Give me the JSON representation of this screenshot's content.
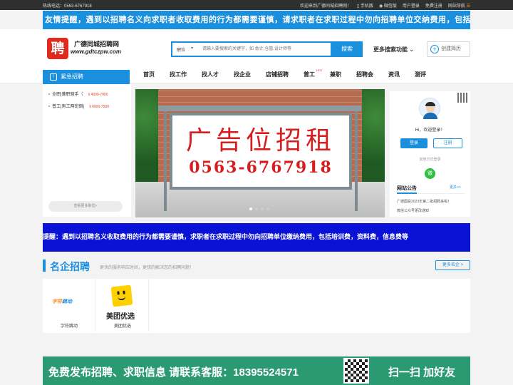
{
  "topbar": {
    "hotline": "热线电话：0563-6767918",
    "welcome": "欢迎来到广德同城招聘网！",
    "mobile": "手机版",
    "wechat": "微信版",
    "user_login": "用户登录",
    "register": "免费注册",
    "site_nav": "网站导航"
  },
  "ticker": "友情提醒，遇到以招聘名义向求职者收取费用的行为都需要谨慎，请求职者在求职过程中勿向招聘单位交纳费用，包括培训费，资料费，信息费，手机及钱物等！",
  "header": {
    "logo_char": "聘",
    "site_name": "广德同城招聘网",
    "domain": "www.gdtczpw.com",
    "search_type": "职位",
    "search_placeholder": "请输入要搜索的关键字，如 会计,仓管,设计师等",
    "search_button": "搜索",
    "more_search": "更多搜索功能",
    "create_resume": "创建简历"
  },
  "nav": {
    "category": "紧急招聘",
    "items": [
      "首页",
      "找工作",
      "找人才",
      "找企业",
      "店铺招聘",
      "普工",
      "兼职",
      "招聘会",
      "资讯",
      "测评"
    ],
    "hot_badge": "HOT"
  },
  "urgent_jobs": [
    {
      "title": "全职|兼职骑手（",
      "salary": "￥4000-7000"
    },
    {
      "title": "普工|男工两班倒|",
      "salary": "￥6000-7500"
    }
  ],
  "more_jobs": "查看更多职位>",
  "banner": {
    "title": "广告位招租",
    "phone": "0563-6767918"
  },
  "user_panel": {
    "welcome": "Hi，欢迎登录！",
    "login": "登录",
    "register": "注册",
    "other_login": "其他方式登录",
    "wechat_icon": "微"
  },
  "notice": {
    "title": "网站公告",
    "more": "更多>>",
    "items": [
      "广德国投2023年第二批招聘来啦！",
      "微信公众号更改通知"
    ]
  },
  "ticker2": "提醒：遇到以招聘名义收取费用的行为都需要谨慎，求职者在求职过程中勿向招聘单位缴纳费用，包括培训费，资料费，信息费等",
  "famous": {
    "title": "名企招聘",
    "subtitle": "更快的服务响应时间，更快的解决您的招聘问题！",
    "more": "更多名企 >",
    "companies": [
      {
        "name": "字符跳动",
        "logo_text_a": "字符",
        "logo_text_b": "跳动"
      },
      {
        "name": "美团优选",
        "logo_text": "美团优选"
      }
    ]
  },
  "bottom_banner": {
    "text": "免费发布招聘、求职信息 请联系客服：18395524571",
    "scan": "扫一扫 加好友"
  },
  "colors": {
    "primary": "#1a8fde",
    "accent_red": "#e02a1e",
    "ticker2_bg": "#0a12d6",
    "bottom_bg": "#2b9a72"
  }
}
